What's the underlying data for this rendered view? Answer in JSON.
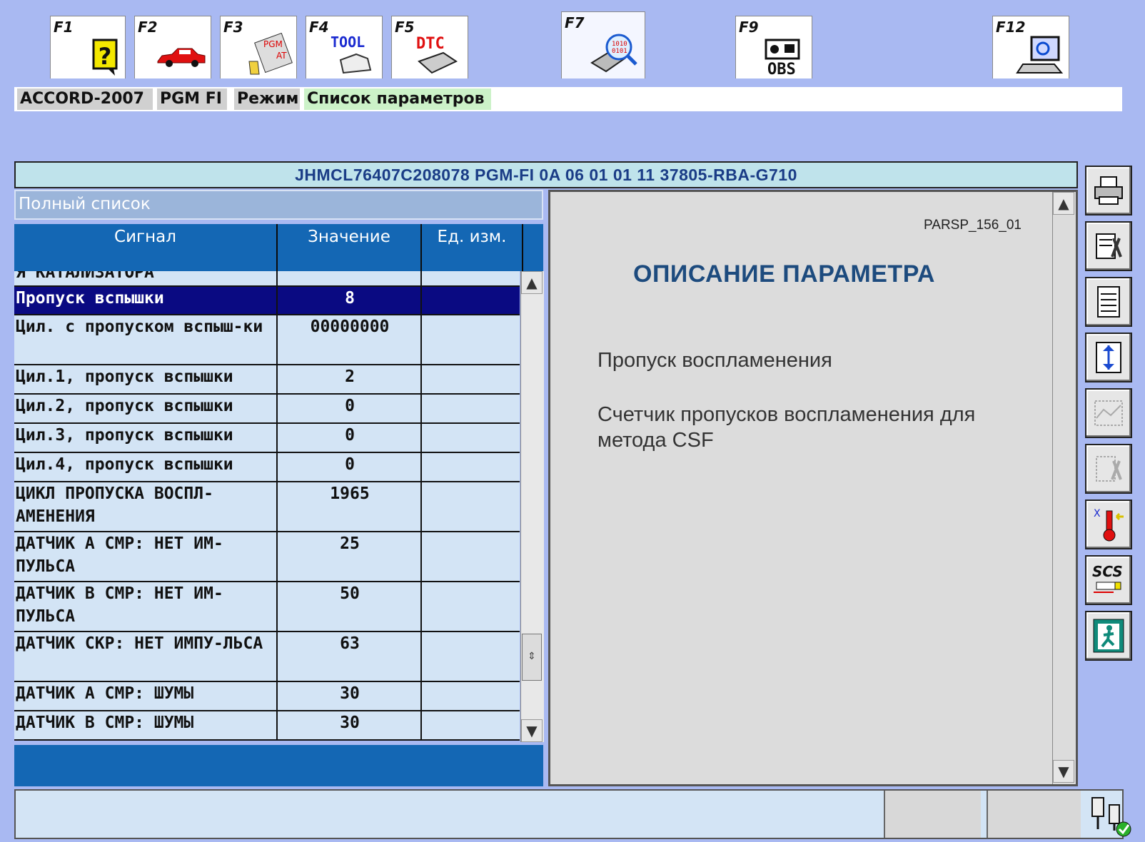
{
  "ftabs": [
    {
      "key": "F1",
      "icon": "help-icon"
    },
    {
      "key": "F2",
      "icon": "car-icon"
    },
    {
      "key": "F3",
      "icon": "pgm-at-icon"
    },
    {
      "key": "F4",
      "icon": "tool-icon",
      "text": "TOOL"
    },
    {
      "key": "F5",
      "icon": "dtc-icon",
      "text": "DTC"
    },
    {
      "key": "F7",
      "icon": "data-magnifier-icon"
    },
    {
      "key": "F9",
      "icon": "obs-camera-icon",
      "text": "OBS"
    },
    {
      "key": "F12",
      "icon": "computer-search-icon"
    }
  ],
  "breadcrumb": {
    "model": "ACCORD-2007",
    "system": "PGM FI",
    "mode": "Режим",
    "screen": "Список параметров"
  },
  "vin_bar": "JHMCL76407C208078  PGM-FI  0A 06 01 01 11  37805-RBA-G710",
  "list": {
    "header": "Полный список",
    "columns": {
      "signal": "Сигнал",
      "value": "Значение",
      "unit": "Ед. изм."
    },
    "rows": [
      {
        "signal": "Я КАТАЛИЗАТОРА",
        "value": "",
        "unit": ""
      },
      {
        "signal": "Пропуск вспышки",
        "value": "8",
        "unit": "",
        "selected": true
      },
      {
        "signal": "Цил. с пропуском вспыш-ки",
        "value": "00000000",
        "unit": ""
      },
      {
        "signal": "Цил.1, пропуск вспышки",
        "value": "2",
        "unit": ""
      },
      {
        "signal": "Цил.2, пропуск вспышки",
        "value": "0",
        "unit": ""
      },
      {
        "signal": "Цил.3, пропуск вспышки",
        "value": "0",
        "unit": ""
      },
      {
        "signal": "Цил.4, пропуск вспышки",
        "value": "0",
        "unit": ""
      },
      {
        "signal": "ЦИКЛ ПРОПУСКА ВОСПЛ-АМЕНЕНИЯ",
        "value": "1965",
        "unit": ""
      },
      {
        "signal": "ДАТЧИК А СМР: НЕТ ИМ-ПУЛЬСА",
        "value": "25",
        "unit": ""
      },
      {
        "signal": "ДАТЧИК В СМР: НЕТ ИМ-ПУЛЬСА",
        "value": "50",
        "unit": ""
      },
      {
        "signal": "ДАТЧИК СКР: НЕТ ИМПУ-ЛЬСА",
        "value": "63",
        "unit": ""
      },
      {
        "signal": "ДАТЧИК А СМР: ШУМЫ",
        "value": "30",
        "unit": ""
      },
      {
        "signal": "ДАТЧИК В СМР: ШУМЫ",
        "value": "30",
        "unit": ""
      }
    ]
  },
  "description": {
    "code": "PARSP_156_01",
    "title": "ОПИСАНИЕ ПАРАМЕТРА",
    "name": "Пропуск воспламенения",
    "text": "Счетчик пропусков воспламенения для метода CSF"
  },
  "toolbar": [
    {
      "name": "print-icon"
    },
    {
      "name": "settings-tools-icon"
    },
    {
      "name": "list-view-icon"
    },
    {
      "name": "sort-vertical-icon"
    },
    {
      "name": "graph-disabled-icon"
    },
    {
      "name": "tools-disabled-icon"
    },
    {
      "name": "temperature-icon"
    },
    {
      "name": "scs-connector-icon",
      "text": "SCS"
    },
    {
      "name": "exit-icon"
    }
  ],
  "status": {
    "connection_icon": "connection-ok-icon"
  },
  "colors": {
    "background": "#a9b9f2",
    "header_blue": "#1467b4",
    "selected_row": "#0a0a82",
    "vin_bar": "#bfe3eb"
  }
}
